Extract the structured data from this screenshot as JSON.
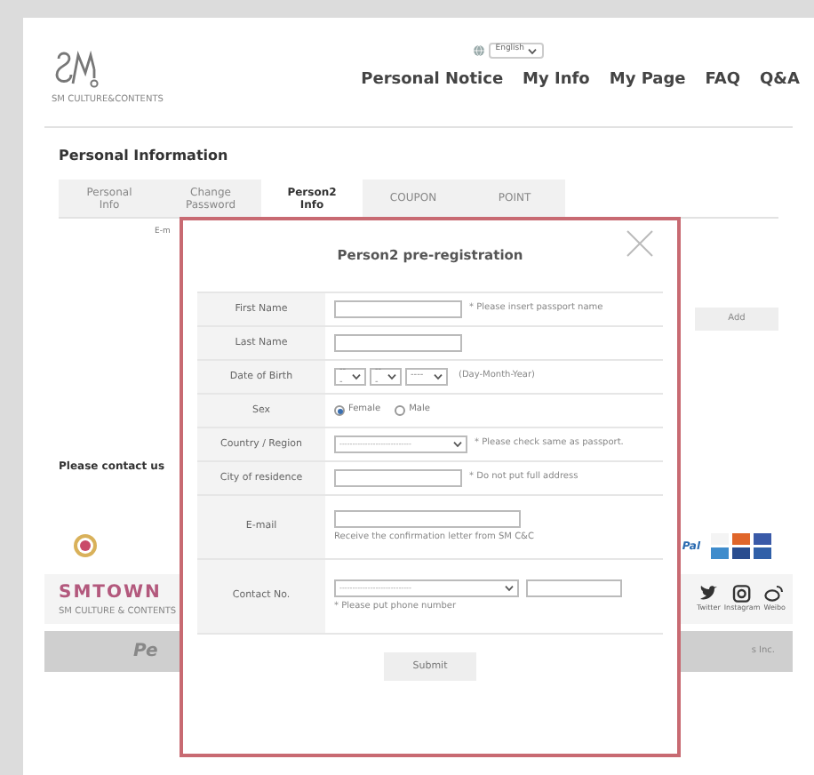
{
  "header": {
    "logo_caption": "SM CULTURE&CONTENTS",
    "language": "English",
    "nav": [
      "Personal Notice",
      "My Info",
      "My Page",
      "FAQ",
      "Q&A"
    ]
  },
  "section_title": "Personal Information",
  "tabs": [
    {
      "label": "Personal Info",
      "selected": false
    },
    {
      "label": "Change Password",
      "selected": false
    },
    {
      "label": "Person2 Info",
      "selected": true
    },
    {
      "label": "COUPON",
      "selected": false
    },
    {
      "label": "POINT",
      "selected": false
    }
  ],
  "background_field_label": "E-m",
  "add_button": "Add",
  "contact_heading": "Please contact us",
  "payment_text": "Pal",
  "footer": {
    "brand": "SMTOWN",
    "brand_sub": "SM CULTURE & CONTENTS",
    "social": [
      "Twitter",
      "Instagram",
      "Weibo"
    ],
    "bar_left": "Pe",
    "bar_right": "s Inc."
  },
  "modal": {
    "title": "Person2 pre-registration",
    "fields": [
      {
        "kind": "text",
        "label": "First Name",
        "note": "* Please insert passport name"
      },
      {
        "kind": "text",
        "label": "Last Name"
      },
      {
        "kind": "date",
        "label": "Date of Birth",
        "selects": [
          "---",
          "---",
          "----"
        ],
        "note": "(Day-Month-Year)"
      },
      {
        "kind": "radio",
        "label": "Sex",
        "options": [
          {
            "label": "Female",
            "selected": true
          },
          {
            "label": "Male",
            "selected": false
          }
        ]
      },
      {
        "kind": "select",
        "label": "Country / Region",
        "value": "----------------------------",
        "note": "* Please check same as passport."
      },
      {
        "kind": "text",
        "label": "City of residence",
        "note": "* Do not put full address"
      },
      {
        "kind": "email",
        "label": "E-mail",
        "help": "Receive the confirmation letter from SM C&C"
      },
      {
        "kind": "phone",
        "label": "Contact No.",
        "value": "----------------------------",
        "help": "* Please put phone number"
      }
    ],
    "submit": "Submit"
  }
}
